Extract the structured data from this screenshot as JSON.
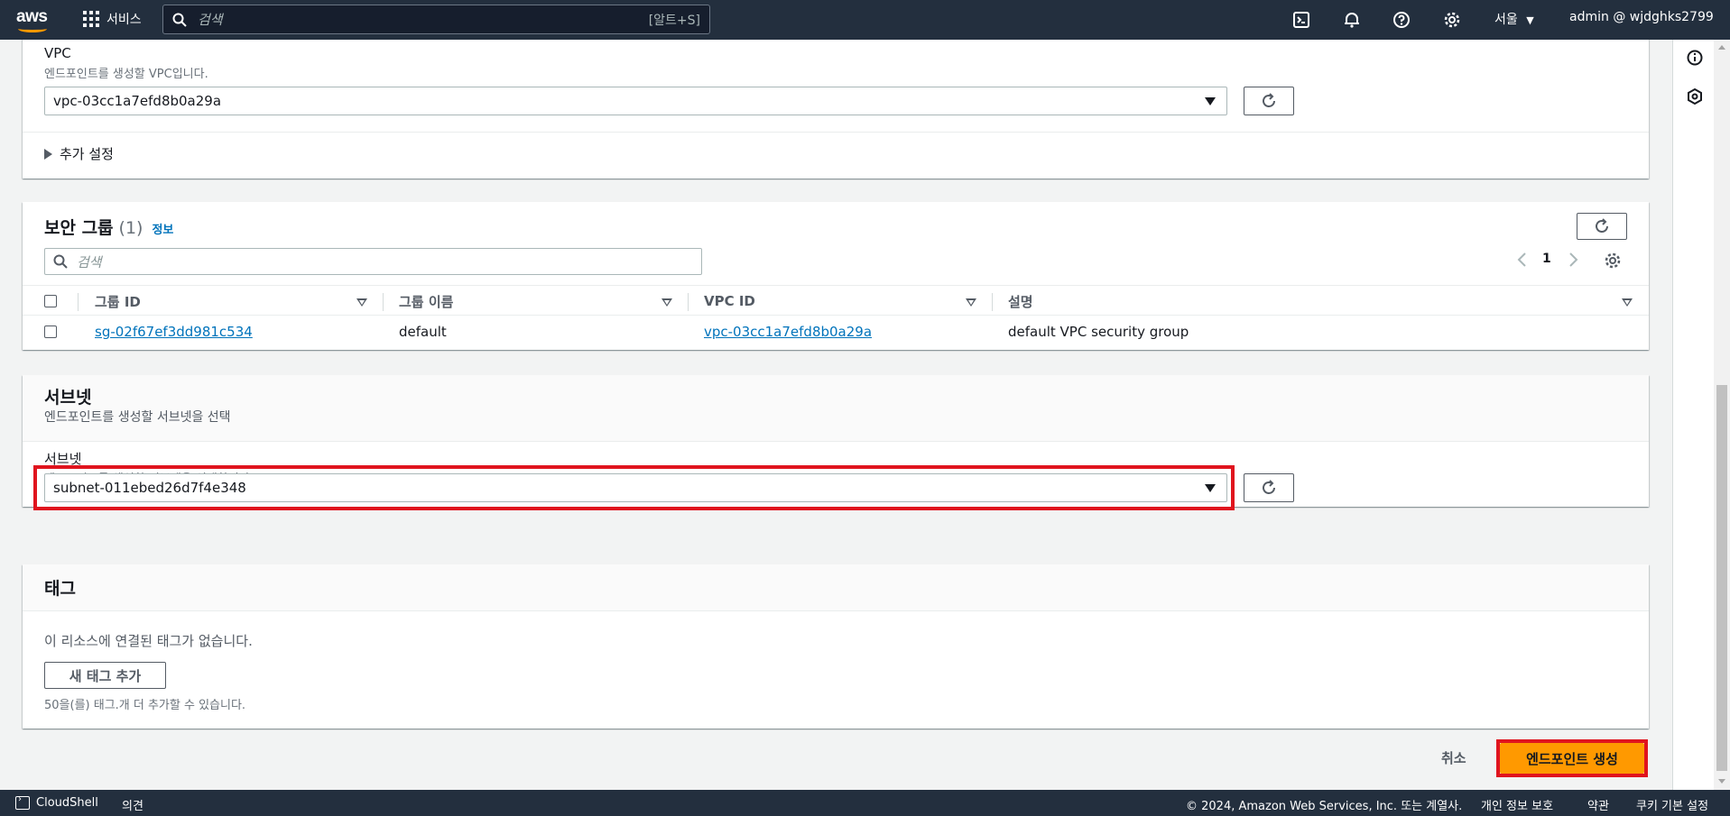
{
  "topbar": {
    "logo_text": "aws",
    "services_label": "서비스",
    "search_placeholder": "검색",
    "search_shortcut": "[알트+S]",
    "region": "서울",
    "account": "admin @ wjdghks2799"
  },
  "vpc_section": {
    "label": "VPC",
    "description": "엔드포인트를 생성할 VPC입니다.",
    "selected_value": "vpc-03cc1a7efd8b0a29a",
    "additional_settings": "추가 설정"
  },
  "security_groups": {
    "title": "보안 그룹",
    "count": "(1)",
    "info_link": "정보",
    "search_placeholder": "검색",
    "page_number": "1",
    "columns": [
      "그룹 ID",
      "그룹 이름",
      "VPC ID",
      "설명"
    ],
    "rows": [
      {
        "group_id": "sg-02f67ef3dd981c534",
        "group_name": "default",
        "vpc_id": "vpc-03cc1a7efd8b0a29a",
        "description": "default VPC security group"
      }
    ]
  },
  "subnet_section": {
    "title": "서브넷",
    "subtitle": "엔드포인트를 생성할 서브넷을 선택",
    "label": "서브넷",
    "description": "엔드포인트를 생성할 서브넷을 선택합니다.",
    "selected_value": "subnet-011ebed26d7f4e348"
  },
  "tags_section": {
    "title": "태그",
    "empty_text": "이 리소스에 연결된 태그가 없습니다.",
    "add_button": "새 태그 추가",
    "hint": "50을(를) 태그.개 더 추가할 수 있습니다."
  },
  "actions": {
    "cancel": "취소",
    "create": "엔드포인트 생성"
  },
  "footer": {
    "cloudshell": "CloudShell",
    "feedback": "의견",
    "copyright": "© 2024, Amazon Web Services, Inc. 또는 계열사.",
    "privacy": "개인 정보 보호",
    "terms": "약관",
    "cookies": "쿠키 기본 설정"
  },
  "colors": {
    "topbar": "#232f3e",
    "primary_button": "#ff9900",
    "link": "#0073bb",
    "highlight": "#e0141e"
  }
}
